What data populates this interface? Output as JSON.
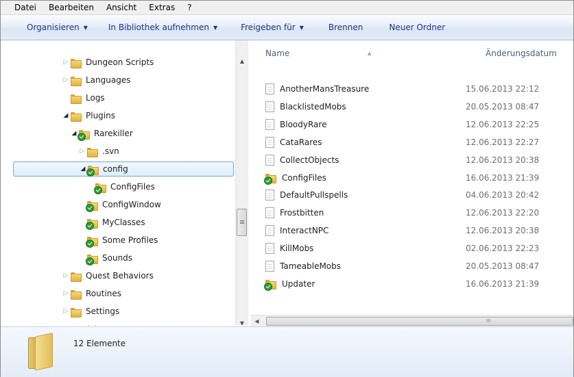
{
  "menu": [
    "Datei",
    "Bearbeiten",
    "Ansicht",
    "Extras",
    "?"
  ],
  "toolbar": {
    "organize": "Organisieren",
    "library": "In Bibliothek aufnehmen",
    "share": "Freigeben für",
    "burn": "Brennen",
    "new_folder": "Neuer Ordner"
  },
  "nav": [
    {
      "label": "Dungeon Scripts",
      "state": "collapsed",
      "icon": "folder"
    },
    {
      "label": "Languages",
      "state": "collapsed",
      "icon": "folder"
    },
    {
      "label": "Logs",
      "state": "none",
      "icon": "folder"
    },
    {
      "label": "Plugins",
      "state": "expanded",
      "icon": "folder"
    },
    {
      "label": "Rarekiller",
      "state": "expanded",
      "icon": "svn-folder"
    },
    {
      "label": ".svn",
      "state": "collapsed",
      "icon": "folder"
    },
    {
      "label": "config",
      "state": "expanded",
      "icon": "svn-folder",
      "selected": true
    },
    {
      "label": "ConfigFiles",
      "state": "none",
      "icon": "svn-folder"
    },
    {
      "label": "ConfigWindow",
      "state": "none",
      "icon": "svn-folder"
    },
    {
      "label": "MyClasses",
      "state": "none",
      "icon": "svn-folder"
    },
    {
      "label": "Some Profiles",
      "state": "none",
      "icon": "svn-folder"
    },
    {
      "label": "Sounds",
      "state": "none",
      "icon": "svn-folder"
    },
    {
      "label": "Quest Behaviors",
      "state": "collapsed",
      "icon": "folder"
    },
    {
      "label": "Routines",
      "state": "collapsed",
      "icon": "folder"
    },
    {
      "label": "Settings",
      "state": "collapsed",
      "icon": "folder"
    },
    {
      "label": "spiele",
      "state": "collapsed",
      "icon": "folder"
    }
  ],
  "columns": {
    "name": "Name",
    "date": "Änderungsdatum"
  },
  "files": [
    {
      "name": "AnotherMansTreasure",
      "date": "15.06.2013 22:12",
      "icon": "file"
    },
    {
      "name": "BlacklistedMobs",
      "date": "20.05.2013 08:47",
      "icon": "file"
    },
    {
      "name": "BloodyRare",
      "date": "12.06.2013 22:25",
      "icon": "file"
    },
    {
      "name": "CataRares",
      "date": "12.06.2013 22:27",
      "icon": "file"
    },
    {
      "name": "CollectObjects",
      "date": "12.06.2013 20:38",
      "icon": "file"
    },
    {
      "name": "ConfigFiles",
      "date": "16.06.2013 21:39",
      "icon": "svn-folder"
    },
    {
      "name": "DefaultPullspells",
      "date": "04.06.2013 20:42",
      "icon": "file"
    },
    {
      "name": "Frostbitten",
      "date": "12.06.2013 22:20",
      "icon": "file"
    },
    {
      "name": "InteractNPC",
      "date": "12.06.2013 20:38",
      "icon": "file"
    },
    {
      "name": "KillMobs",
      "date": "02.06.2013 22:23",
      "icon": "file"
    },
    {
      "name": "TameableMobs",
      "date": "20.05.2013 08:47",
      "icon": "file"
    },
    {
      "name": "Updater",
      "date": "16.06.2013 21:39",
      "icon": "svn-file"
    }
  ],
  "details": {
    "count": "12 Elemente"
  }
}
